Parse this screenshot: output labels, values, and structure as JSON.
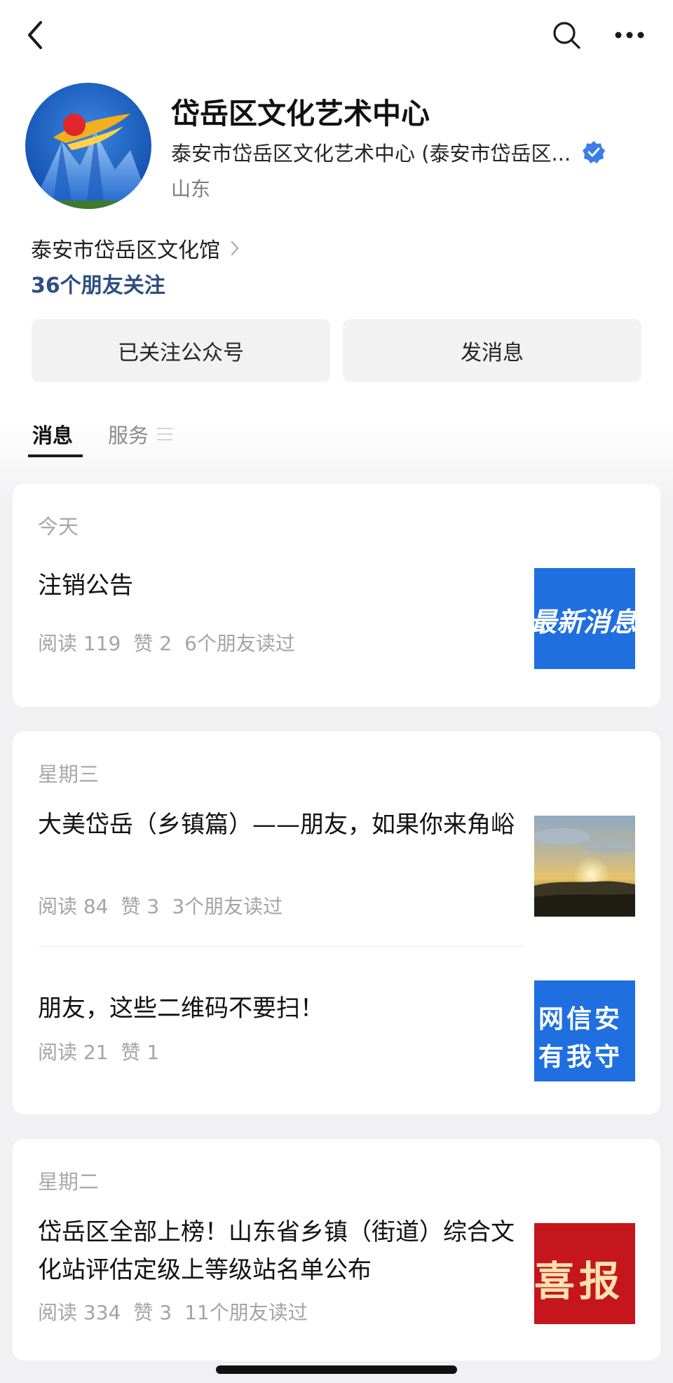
{
  "account": {
    "name": "岱岳区文化艺术中心",
    "full_name": "泰安市岱岳区文化艺术中心 (泰安市岱岳区...",
    "region": "山东",
    "organization": "泰安市岱岳区文化馆",
    "friends_following": "36个朋友关注"
  },
  "actions": {
    "follow_label": "已关注公众号",
    "message_label": "发消息"
  },
  "tabs": [
    {
      "label": "消息"
    },
    {
      "label": "服务"
    }
  ],
  "groups": [
    {
      "day": "今天",
      "articles": [
        {
          "title": "注销公告",
          "reads": "阅读 119",
          "likes": "赞 2",
          "friends_read": "6个朋友读过",
          "thumb_text": "最新消息"
        }
      ]
    },
    {
      "day": "星期三",
      "articles": [
        {
          "title": "大美岱岳（乡镇篇）——朋友，如果你来角峪",
          "reads": "阅读 84",
          "likes": "赞 3",
          "friends_read": "3个朋友读过"
        },
        {
          "title": "朋友，这些二维码不要扫！",
          "reads": "阅读 21",
          "likes": "赞 1",
          "friends_read": "",
          "thumb_text": [
            "网信安",
            "有我守"
          ]
        }
      ]
    },
    {
      "day": "星期二",
      "articles": [
        {
          "title": "岱岳区全部上榜！山东省乡镇（街道）综合文化站评估定级上等级站名单公布",
          "reads": "阅读 334",
          "likes": "赞 3",
          "friends_read": "11个朋友读过",
          "thumb_text": "喜报"
        }
      ]
    }
  ],
  "colors": {
    "link_blue": "#2d4f80",
    "verified_blue": "#3a7ee6",
    "thumb_blue": "#1f6fe0",
    "thumb_red": "#c4161c"
  },
  "icons": [
    "back-icon",
    "search-icon",
    "more-icon",
    "verified-icon",
    "chevron-right-icon",
    "menu-icon"
  ]
}
